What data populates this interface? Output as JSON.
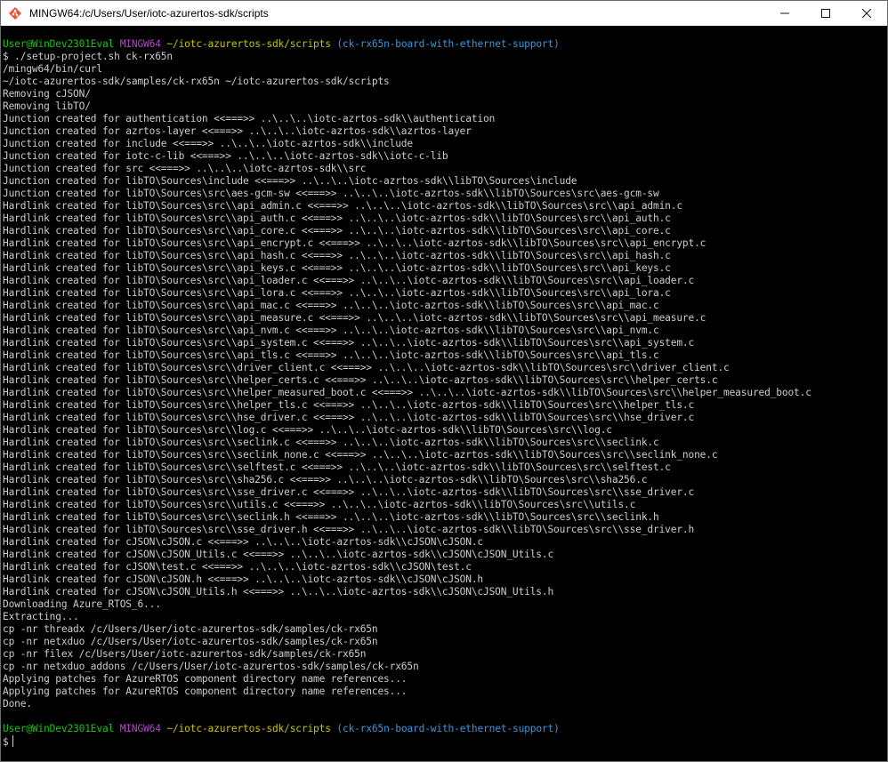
{
  "window": {
    "title": "MINGW64:/c/Users/User/iotc-azurertos-sdk/scripts",
    "icon": "mingw-icon",
    "controls": [
      "minimize-icon",
      "maximize-icon",
      "close-icon"
    ]
  },
  "prompt1": {
    "user": "User@WinDev2301Eval",
    "env": "MINGW64",
    "path": "~/iotc-azurertos-sdk/scripts",
    "branch": "(ck-rx65n-board-with-ethernet-support)"
  },
  "output_lines": [
    "$ ./setup-project.sh ck-rx65n",
    "/mingw64/bin/curl",
    "~/iotc-azurertos-sdk/samples/ck-rx65n ~/iotc-azurertos-sdk/scripts",
    "Removing cJSON/",
    "Removing libTO/",
    "Junction created for authentication <<===>> ..\\..\\..\\iotc-azrtos-sdk\\\\authentication",
    "Junction created for azrtos-layer <<===>> ..\\..\\..\\iotc-azrtos-sdk\\\\azrtos-layer",
    "Junction created for include <<===>> ..\\..\\..\\iotc-azrtos-sdk\\\\include",
    "Junction created for iotc-c-lib <<===>> ..\\..\\..\\iotc-azrtos-sdk\\\\iotc-c-lib",
    "Junction created for src <<===>> ..\\..\\..\\iotc-azrtos-sdk\\\\src",
    "Junction created for libTO\\Sources\\include <<===>> ..\\..\\..\\iotc-azrtos-sdk\\\\libTO\\Sources\\include",
    "Junction created for libTO\\Sources\\src\\aes-gcm-sw <<===>> ..\\..\\..\\iotc-azrtos-sdk\\\\libTO\\Sources\\src\\aes-gcm-sw",
    "Hardlink created for libTO\\Sources\\src\\\\api_admin.c <<===>> ..\\..\\..\\iotc-azrtos-sdk\\\\libTO\\Sources\\src\\\\api_admin.c",
    "Hardlink created for libTO\\Sources\\src\\\\api_auth.c <<===>> ..\\..\\..\\iotc-azrtos-sdk\\\\libTO\\Sources\\src\\\\api_auth.c",
    "Hardlink created for libTO\\Sources\\src\\\\api_core.c <<===>> ..\\..\\..\\iotc-azrtos-sdk\\\\libTO\\Sources\\src\\\\api_core.c",
    "Hardlink created for libTO\\Sources\\src\\\\api_encrypt.c <<===>> ..\\..\\..\\iotc-azrtos-sdk\\\\libTO\\Sources\\src\\\\api_encrypt.c",
    "Hardlink created for libTO\\Sources\\src\\\\api_hash.c <<===>> ..\\..\\..\\iotc-azrtos-sdk\\\\libTO\\Sources\\src\\\\api_hash.c",
    "Hardlink created for libTO\\Sources\\src\\\\api_keys.c <<===>> ..\\..\\..\\iotc-azrtos-sdk\\\\libTO\\Sources\\src\\\\api_keys.c",
    "Hardlink created for libTO\\Sources\\src\\\\api_loader.c <<===>> ..\\..\\..\\iotc-azrtos-sdk\\\\libTO\\Sources\\src\\\\api_loader.c",
    "Hardlink created for libTO\\Sources\\src\\\\api_lora.c <<===>> ..\\..\\..\\iotc-azrtos-sdk\\\\libTO\\Sources\\src\\\\api_lora.c",
    "Hardlink created for libTO\\Sources\\src\\\\api_mac.c <<===>> ..\\..\\..\\iotc-azrtos-sdk\\\\libTO\\Sources\\src\\\\api_mac.c",
    "Hardlink created for libTO\\Sources\\src\\\\api_measure.c <<===>> ..\\..\\..\\iotc-azrtos-sdk\\\\libTO\\Sources\\src\\\\api_measure.c",
    "Hardlink created for libTO\\Sources\\src\\\\api_nvm.c <<===>> ..\\..\\..\\iotc-azrtos-sdk\\\\libTO\\Sources\\src\\\\api_nvm.c",
    "Hardlink created for libTO\\Sources\\src\\\\api_system.c <<===>> ..\\..\\..\\iotc-azrtos-sdk\\\\libTO\\Sources\\src\\\\api_system.c",
    "Hardlink created for libTO\\Sources\\src\\\\api_tls.c <<===>> ..\\..\\..\\iotc-azrtos-sdk\\\\libTO\\Sources\\src\\\\api_tls.c",
    "Hardlink created for libTO\\Sources\\src\\\\driver_client.c <<===>> ..\\..\\..\\iotc-azrtos-sdk\\\\libTO\\Sources\\src\\\\driver_client.c",
    "Hardlink created for libTO\\Sources\\src\\\\helper_certs.c <<===>> ..\\..\\..\\iotc-azrtos-sdk\\\\libTO\\Sources\\src\\\\helper_certs.c",
    "Hardlink created for libTO\\Sources\\src\\\\helper_measured_boot.c <<===>> ..\\..\\..\\iotc-azrtos-sdk\\\\libTO\\Sources\\src\\\\helper_measured_boot.c",
    "Hardlink created for libTO\\Sources\\src\\\\helper_tls.c <<===>> ..\\..\\..\\iotc-azrtos-sdk\\\\libTO\\Sources\\src\\\\helper_tls.c",
    "Hardlink created for libTO\\Sources\\src\\\\hse_driver.c <<===>> ..\\..\\..\\iotc-azrtos-sdk\\\\libTO\\Sources\\src\\\\hse_driver.c",
    "Hardlink created for libTO\\Sources\\src\\\\log.c <<===>> ..\\..\\..\\iotc-azrtos-sdk\\\\libTO\\Sources\\src\\\\log.c",
    "Hardlink created for libTO\\Sources\\src\\\\seclink.c <<===>> ..\\..\\..\\iotc-azrtos-sdk\\\\libTO\\Sources\\src\\\\seclink.c",
    "Hardlink created for libTO\\Sources\\src\\\\seclink_none.c <<===>> ..\\..\\..\\iotc-azrtos-sdk\\\\libTO\\Sources\\src\\\\seclink_none.c",
    "Hardlink created for libTO\\Sources\\src\\\\selftest.c <<===>> ..\\..\\..\\iotc-azrtos-sdk\\\\libTO\\Sources\\src\\\\selftest.c",
    "Hardlink created for libTO\\Sources\\src\\\\sha256.c <<===>> ..\\..\\..\\iotc-azrtos-sdk\\\\libTO\\Sources\\src\\\\sha256.c",
    "Hardlink created for libTO\\Sources\\src\\\\sse_driver.c <<===>> ..\\..\\..\\iotc-azrtos-sdk\\\\libTO\\Sources\\src\\\\sse_driver.c",
    "Hardlink created for libTO\\Sources\\src\\\\utils.c <<===>> ..\\..\\..\\iotc-azrtos-sdk\\\\libTO\\Sources\\src\\\\utils.c",
    "Hardlink created for libTO\\Sources\\src\\\\seclink.h <<===>> ..\\..\\..\\iotc-azrtos-sdk\\\\libTO\\Sources\\src\\\\seclink.h",
    "Hardlink created for libTO\\Sources\\src\\\\sse_driver.h <<===>> ..\\..\\..\\iotc-azrtos-sdk\\\\libTO\\Sources\\src\\\\sse_driver.h",
    "Hardlink created for cJSON\\cJSON.c <<===>> ..\\..\\..\\iotc-azrtos-sdk\\\\cJSON\\cJSON.c",
    "Hardlink created for cJSON\\cJSON_Utils.c <<===>> ..\\..\\..\\iotc-azrtos-sdk\\\\cJSON\\cJSON_Utils.c",
    "Hardlink created for cJSON\\test.c <<===>> ..\\..\\..\\iotc-azrtos-sdk\\\\cJSON\\test.c",
    "Hardlink created for cJSON\\cJSON.h <<===>> ..\\..\\..\\iotc-azrtos-sdk\\\\cJSON\\cJSON.h",
    "Hardlink created for cJSON\\cJSON_Utils.h <<===>> ..\\..\\..\\iotc-azrtos-sdk\\\\cJSON\\cJSON_Utils.h",
    "Downloading Azure_RTOS_6...",
    "Extracting...",
    "cp -nr threadx /c/Users/User/iotc-azurertos-sdk/samples/ck-rx65n",
    "cp -nr netxduo /c/Users/User/iotc-azurertos-sdk/samples/ck-rx65n",
    "cp -nr filex /c/Users/User/iotc-azurertos-sdk/samples/ck-rx65n",
    "cp -nr netxduo_addons /c/Users/User/iotc-azurertos-sdk/samples/ck-rx65n",
    "Applying patches for AzureRTOS component directory name references...",
    "Applying patches for AzureRTOS component directory name references...",
    "Done.",
    ""
  ],
  "prompt2": {
    "user": "User@WinDev2301Eval",
    "env": "MINGW64",
    "path": "~/iotc-azurertos-sdk/scripts",
    "branch": "(ck-rx65n-board-with-ethernet-support)",
    "input": "$"
  },
  "colors": {
    "background": "#000000",
    "text": "#cccccc",
    "user": "#16c60c",
    "env": "#b148c6",
    "path": "#c6c600",
    "branch": "#3a96dd"
  }
}
